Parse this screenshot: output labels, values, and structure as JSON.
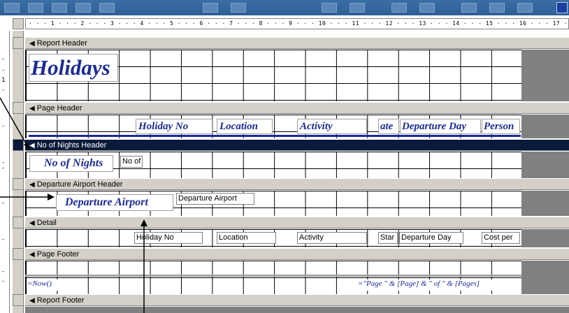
{
  "ruler": {
    "text": "· · · 1 · · · 2 · · · 3 · · · 4 · · · 5 · · · 6 · · · 7 · · · 8 · · · 9 · · · 10 · · · 11 · · · 12 · · · 13 · · · 14 · · · 15 · · · 16 · · · 17 ·"
  },
  "vertical_ruler": {
    "tick_1": "1"
  },
  "sections": {
    "report_header": "Report Header",
    "page_header": "Page Header",
    "nights_header": "No of Nights Header",
    "airport_header": "Departure Airport Header",
    "detail": "Detail",
    "page_footer": "Page Footer",
    "report_footer": "Report Footer"
  },
  "report_header": {
    "title": "Holidays"
  },
  "page_header": {
    "labels": [
      "Holiday No",
      "Location",
      "Activity",
      "ate",
      "Departure Day",
      "Person"
    ]
  },
  "nights_header": {
    "label": "No of Nights",
    "textbox": "No of"
  },
  "airport_header": {
    "label": "Departure Airport",
    "textbox": "Departure Airport"
  },
  "detail": {
    "fields": [
      "Holiday No",
      "Location",
      "Activity",
      "Star",
      "Departure Day",
      "Cost per"
    ]
  },
  "page_footer": {
    "now_expr": "=Now()",
    "page_expr": "=\"Page \" & [Page] & \" of \" & [Pages]"
  },
  "colors": {
    "label_text": "#1a2a99",
    "active_bar": "#0a1a3a",
    "section_bar": "#d4d0c8"
  }
}
